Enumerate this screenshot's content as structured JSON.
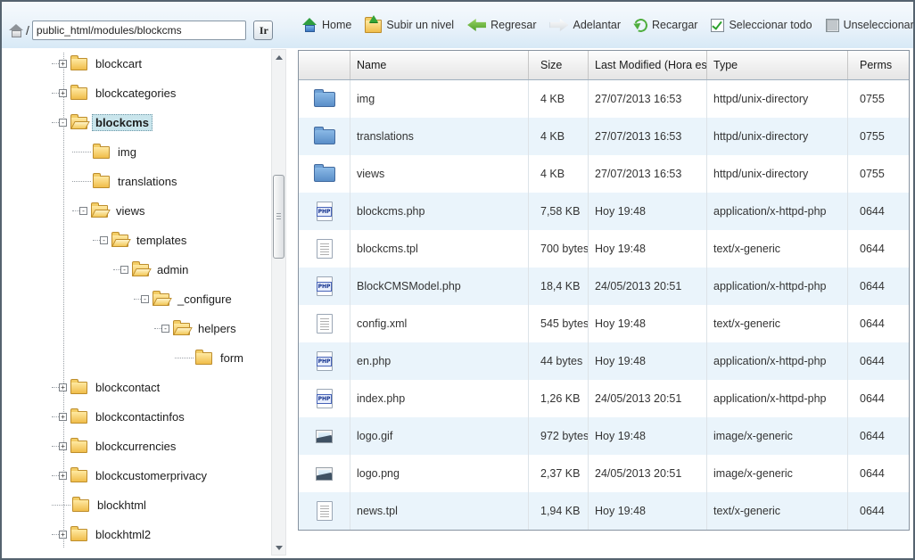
{
  "address_bar": {
    "root_slash": "/",
    "path_value": "public_html/modules/blockcms",
    "go_label": "Ir"
  },
  "toolbar": {
    "items": [
      {
        "label": "Home",
        "icon": "home"
      },
      {
        "label": "Subir un nivel",
        "icon": "folder-up"
      },
      {
        "label": "Regresar",
        "icon": "arrow-left"
      },
      {
        "label": "Adelantar",
        "icon": "arrow-right"
      },
      {
        "label": "Recargar",
        "icon": "refresh"
      },
      {
        "label": "Seleccionar todo",
        "icon": "checkbox-checked"
      },
      {
        "label": "Unseleccionar todo",
        "icon": "checkbox-empty"
      }
    ]
  },
  "tree": {
    "items": [
      {
        "label": "blockcart",
        "expander": "+",
        "folder": "closed",
        "depth": 0,
        "selected": false
      },
      {
        "label": "blockcategories",
        "expander": "+",
        "folder": "closed",
        "depth": 0,
        "selected": false
      },
      {
        "label": "blockcms",
        "expander": "-",
        "folder": "open",
        "depth": 0,
        "selected": true
      },
      {
        "label": "img",
        "expander": "",
        "folder": "closed",
        "depth": 1,
        "selected": false
      },
      {
        "label": "translations",
        "expander": "",
        "folder": "closed",
        "depth": 1,
        "selected": false
      },
      {
        "label": "views",
        "expander": "-",
        "folder": "open",
        "depth": 1,
        "selected": false
      },
      {
        "label": "templates",
        "expander": "-",
        "folder": "open",
        "depth": 2,
        "selected": false
      },
      {
        "label": "admin",
        "expander": "-",
        "folder": "open",
        "depth": 3,
        "selected": false
      },
      {
        "label": "_configure",
        "expander": "-",
        "folder": "open",
        "depth": 4,
        "selected": false
      },
      {
        "label": "helpers",
        "expander": "-",
        "folder": "open",
        "depth": 5,
        "selected": false
      },
      {
        "label": "form",
        "expander": "",
        "folder": "closed",
        "depth": 6,
        "selected": false
      },
      {
        "label": "blockcontact",
        "expander": "+",
        "folder": "closed",
        "depth": 0,
        "selected": false
      },
      {
        "label": "blockcontactinfos",
        "expander": "+",
        "folder": "closed",
        "depth": 0,
        "selected": false
      },
      {
        "label": "blockcurrencies",
        "expander": "+",
        "folder": "closed",
        "depth": 0,
        "selected": false
      },
      {
        "label": "blockcustomerprivacy",
        "expander": "+",
        "folder": "closed",
        "depth": 0,
        "selected": false
      },
      {
        "label": "blockhtml",
        "expander": "",
        "folder": "closed",
        "depth": 0,
        "selected": false
      },
      {
        "label": "blockhtml2",
        "expander": "+",
        "folder": "closed",
        "depth": 0,
        "selected": false
      }
    ]
  },
  "table": {
    "columns": [
      "Name",
      "Size",
      "Last Modified (Hora está",
      "Type",
      "Perms"
    ],
    "rows": [
      {
        "icon": "folder",
        "name": "img",
        "size": "4 KB",
        "modified": "27/07/2013 16:53",
        "type": "httpd/unix-directory",
        "perms": "0755"
      },
      {
        "icon": "folder",
        "name": "translations",
        "size": "4 KB",
        "modified": "27/07/2013 16:53",
        "type": "httpd/unix-directory",
        "perms": "0755"
      },
      {
        "icon": "folder",
        "name": "views",
        "size": "4 KB",
        "modified": "27/07/2013 16:53",
        "type": "httpd/unix-directory",
        "perms": "0755"
      },
      {
        "icon": "php",
        "name": "blockcms.php",
        "size": "7,58 KB",
        "modified": "Hoy 19:48",
        "type": "application/x-httpd-php",
        "perms": "0644"
      },
      {
        "icon": "text",
        "name": "blockcms.tpl",
        "size": "700 bytes",
        "modified": "Hoy 19:48",
        "type": "text/x-generic",
        "perms": "0644"
      },
      {
        "icon": "php",
        "name": "BlockCMSModel.php",
        "size": "18,4 KB",
        "modified": "24/05/2013 20:51",
        "type": "application/x-httpd-php",
        "perms": "0644"
      },
      {
        "icon": "text",
        "name": "config.xml",
        "size": "545 bytes",
        "modified": "Hoy 19:48",
        "type": "text/x-generic",
        "perms": "0644"
      },
      {
        "icon": "php",
        "name": "en.php",
        "size": "44 bytes",
        "modified": "Hoy 19:48",
        "type": "application/x-httpd-php",
        "perms": "0644"
      },
      {
        "icon": "php",
        "name": "index.php",
        "size": "1,26 KB",
        "modified": "24/05/2013 20:51",
        "type": "application/x-httpd-php",
        "perms": "0644"
      },
      {
        "icon": "image",
        "name": "logo.gif",
        "size": "972 bytes",
        "modified": "Hoy 19:48",
        "type": "image/x-generic",
        "perms": "0644"
      },
      {
        "icon": "image",
        "name": "logo.png",
        "size": "2,37 KB",
        "modified": "24/05/2013 20:51",
        "type": "image/x-generic",
        "perms": "0644"
      },
      {
        "icon": "text",
        "name": "news.tpl",
        "size": "1,94 KB",
        "modified": "Hoy 19:48",
        "type": "text/x-generic",
        "perms": "0644"
      }
    ]
  },
  "colors": {
    "selection_highlight": "#c9e5ec",
    "row_stripe": "#eaf4fb",
    "toolbar_green": "#4fae3e",
    "folder_yellow": "#f0bd4a",
    "folder_blue": "#5a8ec8"
  }
}
